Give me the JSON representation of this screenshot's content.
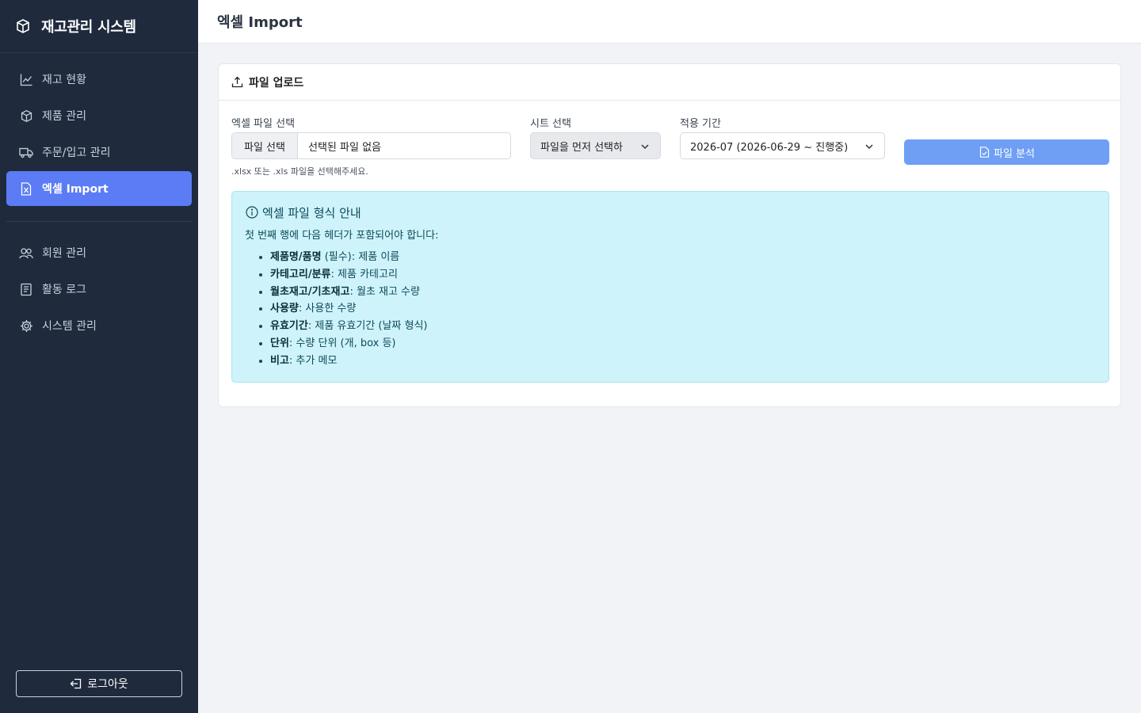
{
  "app": {
    "title": "재고관리 시스템",
    "brand_icon": "box-icon"
  },
  "sidebar": {
    "items": [
      {
        "label": "재고 현황",
        "icon": "chart-line-icon"
      },
      {
        "label": "제품 관리",
        "icon": "box-icon"
      },
      {
        "label": "주문/입고 관리",
        "icon": "truck-icon"
      },
      {
        "label": "엑셀 Import",
        "icon": "file-excel-icon",
        "active": true
      }
    ],
    "items2": [
      {
        "label": "회원 관리",
        "icon": "users-icon"
      },
      {
        "label": "활동 로그",
        "icon": "journal-icon"
      },
      {
        "label": "시스템 관리",
        "icon": "gear-icon"
      }
    ],
    "logout_label": "로그아웃"
  },
  "header": {
    "title": "엑셀 Import"
  },
  "upload": {
    "card_title": "파일 업로드",
    "file_label": "엑셀 파일 선택",
    "file_button": "파일 선택",
    "file_name": "선택된 파일 없음",
    "file_hint": ".xlsx 또는 .xls 파일을 선택해주세요.",
    "sheet_label": "시트 선택",
    "sheet_value": "파일을 먼저 선택하",
    "period_label": "적용 기간",
    "period_value": "2026-07 (2026-06-29 ~ 진행중)",
    "analyze_button": "파일 분석"
  },
  "guide": {
    "title": "엑셀 파일 형식 안내",
    "desc": "첫 번째 행에 다음 헤더가 포함되어야 합니다:",
    "items": [
      {
        "key": "제품명/품명",
        "text": " (필수): 제품 이름"
      },
      {
        "key": "카테고리/분류",
        "text": ": 제품 카테고리"
      },
      {
        "key": "월초재고/기초재고",
        "text": ": 월초 재고 수량"
      },
      {
        "key": "사용량",
        "text": ": 사용한 수량"
      },
      {
        "key": "유효기간",
        "text": ": 제품 유효기간 (날짜 형식)"
      },
      {
        "key": "단위",
        "text": ": 수량 단위 (개, box 등)"
      },
      {
        "key": "비고",
        "text": ": 추가 메모"
      }
    ]
  },
  "colors": {
    "sidebar_bg": "#1f2a3d",
    "accent": "#5b7cf5",
    "button": "#6e9ff5",
    "info_bg": "#cff3fa"
  }
}
